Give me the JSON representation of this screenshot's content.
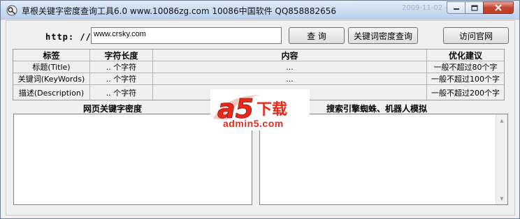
{
  "window": {
    "title": "草根关键字密度查询工具6.0   www.10086zg.com  10086中国软件    QQ858882656",
    "watermark": "2009-11-02  ——"
  },
  "url_bar": {
    "label": "http: //",
    "value": "www.crsky.com"
  },
  "buttons": {
    "search": "查 询",
    "density": "关键词密度查询",
    "site": "访问官网"
  },
  "table": {
    "headers": {
      "label": "标签",
      "length": "字符长度",
      "content": "内容",
      "advice": "优化建议"
    },
    "rows": [
      {
        "label": "标题(Title)",
        "length": ".. 个字符",
        "content": "...",
        "advice": "一般不超过80个字"
      },
      {
        "label": "关键词(KeyWords)",
        "length": ".. 个字符",
        "content": "...",
        "advice": "一般不超过100个字"
      },
      {
        "label": "描述(Description)",
        "length": ".. 个字符",
        "content": "...",
        "advice": "一般不超过200个字"
      }
    ]
  },
  "panels": {
    "left_title": "网页关键字密度",
    "right_title": "搜索引擎蜘蛛、机器人模拟"
  },
  "logo": {
    "brand_mark": "a5",
    "brand_cn": "下载",
    "url": "admin5.com"
  },
  "colors": {
    "logo_red": "#e8281a",
    "titlebar_top": "#e3eefb",
    "close_red": "#c7452f"
  }
}
